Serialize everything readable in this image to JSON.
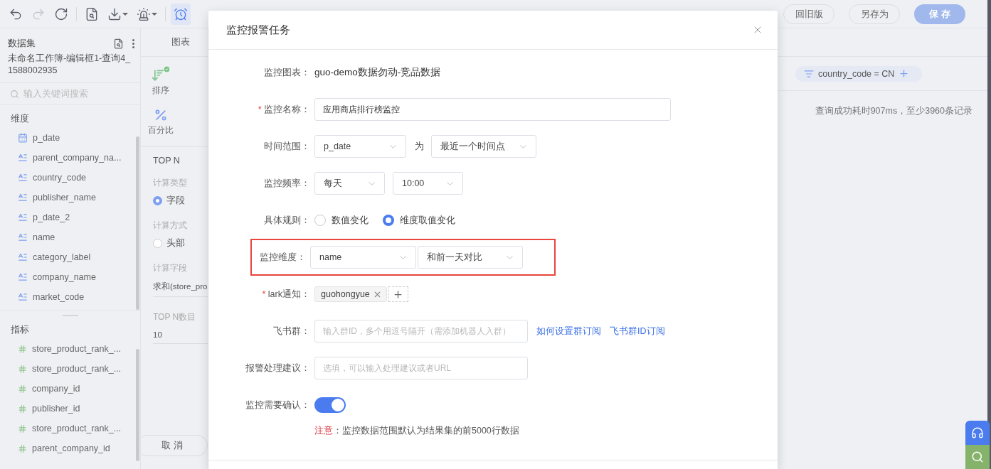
{
  "toolbar": {
    "icons": [
      {
        "kind": "undo",
        "disabled": false,
        "dropdown": false,
        "selected": false
      },
      {
        "kind": "redo",
        "disabled": true,
        "dropdown": false,
        "selected": false
      },
      {
        "kind": "refresh",
        "disabled": false,
        "dropdown": false,
        "selected": false
      },
      {
        "kind": "report",
        "disabled": false,
        "dropdown": false,
        "selected": false
      },
      {
        "kind": "download",
        "disabled": false,
        "dropdown": true,
        "selected": false
      },
      {
        "kind": "alert",
        "disabled": false,
        "dropdown": true,
        "selected": false
      },
      {
        "kind": "alarm",
        "disabled": false,
        "dropdown": false,
        "selected": true
      }
    ],
    "buttons": [
      {
        "label": "回旧版",
        "primary": false
      },
      {
        "label": "另存为",
        "primary": false
      },
      {
        "label": "保 存",
        "primary": true
      }
    ]
  },
  "sidebar": {
    "title": "数据集",
    "dataset_name": "未命名工作簿-编辑框1-查询4_1588002935",
    "search_placeholder": "输入关键词搜索",
    "sections": [
      {
        "title": "维度",
        "items": [
          {
            "kind": "date",
            "label": "p_date"
          },
          {
            "kind": "text",
            "label": "parent_company_na..."
          },
          {
            "kind": "text",
            "label": "country_code"
          },
          {
            "kind": "text",
            "label": "publisher_name"
          },
          {
            "kind": "text",
            "label": "p_date_2"
          },
          {
            "kind": "text",
            "label": "name"
          },
          {
            "kind": "text",
            "label": "category_label"
          },
          {
            "kind": "text",
            "label": "company_name"
          },
          {
            "kind": "text",
            "label": "market_code"
          }
        ]
      },
      {
        "title": "指标",
        "items": [
          {
            "kind": "number",
            "label": "store_product_rank_..."
          },
          {
            "kind": "number",
            "label": "store_product_rank_..."
          },
          {
            "kind": "number",
            "label": "company_id"
          },
          {
            "kind": "number",
            "label": "publisher_id"
          },
          {
            "kind": "number",
            "label": "store_product_rank_..."
          },
          {
            "kind": "number",
            "label": "parent_company_id"
          }
        ]
      }
    ]
  },
  "config_panel": {
    "tab": "图表",
    "tools": [
      {
        "kind": "sort",
        "label": "排序",
        "checked": true
      },
      {
        "kind": "percent",
        "label": "百分比",
        "checked": false
      }
    ],
    "section_title": "TOP N",
    "calc_type": {
      "label": "计算类型",
      "options": [
        {
          "label": "字段",
          "selected": true
        }
      ]
    },
    "calc_method": {
      "label": "计算方式",
      "options": [
        {
          "label": "头部",
          "selected": false
        }
      ]
    },
    "calc_field": {
      "label": "计算字段",
      "value": "求和(store_pro"
    },
    "top_n": {
      "label": "TOP N数目",
      "value": "10"
    },
    "cancel_button": "取 消"
  },
  "filters": [
    {
      "label": "country_code = CN"
    }
  ],
  "query_status": "查询成功耗时907ms，至少3960条记录",
  "dialog": {
    "title": "监控报警任务",
    "required_mark": "*",
    "rows": [
      {
        "kind": "text",
        "label": "监控图表：",
        "required": false,
        "highlighted": false,
        "value": "guo-demo数据勿动-竞品数据"
      },
      {
        "kind": "input",
        "label": "监控名称：",
        "required": true,
        "highlighted": false,
        "value": "应用商店排行榜监控"
      },
      {
        "kind": "selects",
        "label": "时间范围：",
        "required": false,
        "highlighted": false,
        "joiner": "为",
        "selects": [
          {
            "value": "p_date"
          },
          {
            "value": "最近一个时间点"
          }
        ]
      },
      {
        "kind": "selects",
        "label": "监控频率：",
        "required": false,
        "highlighted": false,
        "selects": [
          {
            "value": "每天"
          },
          {
            "value": "10:00"
          }
        ]
      },
      {
        "kind": "radio",
        "label": "具体规则：",
        "required": false,
        "highlighted": false,
        "options": [
          {
            "label": "数值变化",
            "selected": false
          },
          {
            "label": "维度取值变化",
            "selected": true
          }
        ]
      },
      {
        "kind": "selects",
        "label": "监控维度：",
        "required": false,
        "highlighted": true,
        "selects": [
          {
            "value": "name"
          },
          {
            "value": "和前一天对比"
          }
        ]
      },
      {
        "kind": "tags",
        "label": "lark通知：",
        "required": true,
        "highlighted": false,
        "tags": [
          {
            "label": "guohongyue"
          }
        ]
      },
      {
        "kind": "input",
        "label": "飞书群：",
        "required": false,
        "highlighted": false,
        "placeholder": "输入群ID，多个用逗号隔开（需添加机器人入群）",
        "links": [
          "如何设置群订阅",
          "飞书群ID订阅"
        ]
      },
      {
        "kind": "input",
        "label": "报警处理建议：",
        "required": false,
        "highlighted": false,
        "placeholder": "选填，可以输入处理建议或者URL"
      },
      {
        "kind": "switch",
        "label": "监控需要确认：",
        "required": false,
        "highlighted": false,
        "on": true
      }
    ],
    "note": {
      "label": "注意",
      "text": "：监控数据范围默认为结果集的前5000行数据"
    }
  },
  "floating_buttons": [
    {
      "kind": "headset",
      "color": "#4a7cf0"
    },
    {
      "kind": "search",
      "color": "#86b36b"
    }
  ]
}
